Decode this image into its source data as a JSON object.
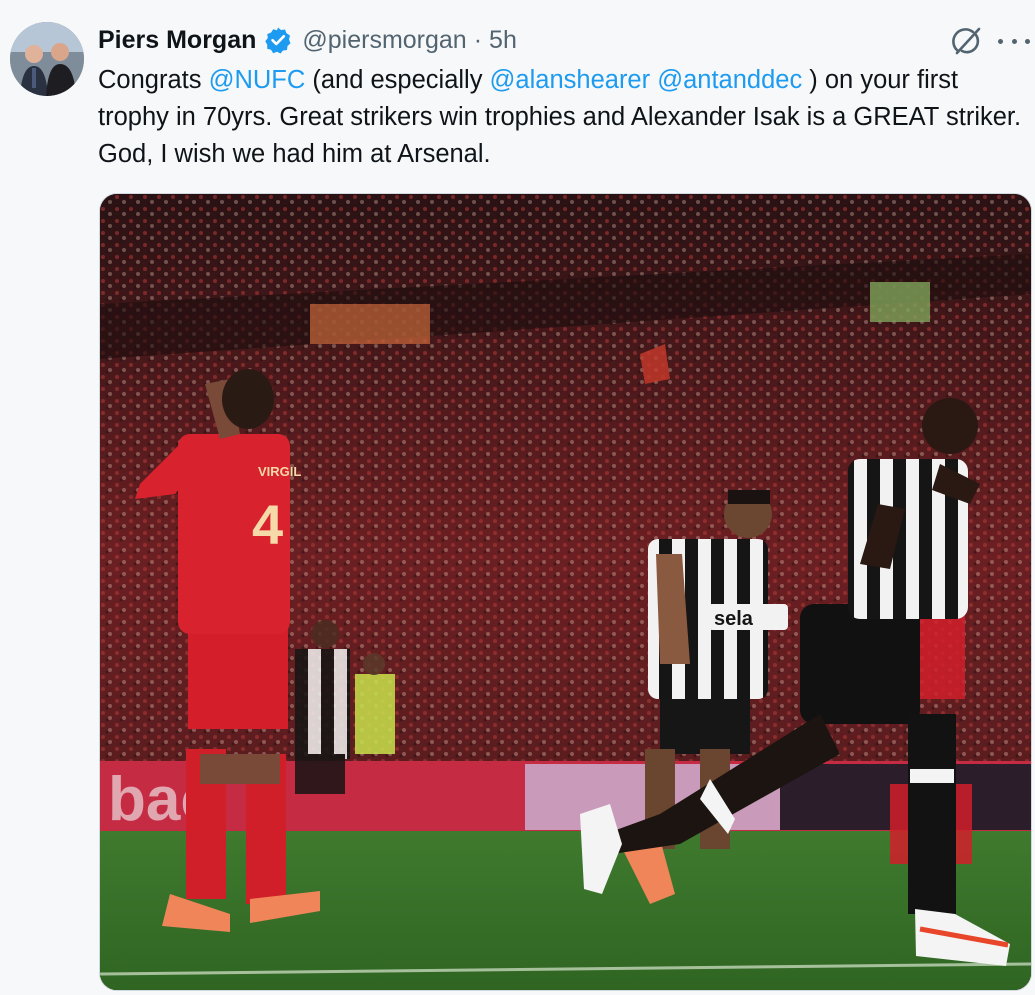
{
  "tweet": {
    "author_name": "Piers Morgan",
    "author_handle": "@piersmorgan",
    "separator": "·",
    "time": "5h",
    "text_parts": [
      {
        "text": "Congrats ",
        "mention": false
      },
      {
        "text": "@NUFC",
        "mention": true
      },
      {
        "text": " (and especially ",
        "mention": false
      },
      {
        "text": "@alanshearer",
        "mention": true
      },
      {
        "text": " ",
        "mention": false
      },
      {
        "text": "@antanddec",
        "mention": true
      },
      {
        "text": " ) on your first trophy in 70yrs. Great strikers win trophies and Alexander Isak is a GREAT striker. God, I wish we had him at Arsenal.",
        "mention": false
      }
    ],
    "photo": {
      "shirt_name": "VIRGIL",
      "shirt_number": "4",
      "sponsor": "sela",
      "board_text": "bac"
    }
  },
  "icons": {
    "verified": "verified-badge-icon",
    "grok": "grok-icon",
    "more": "more-options-icon"
  },
  "colors": {
    "link": "#1d9bf0",
    "verified": "#1d9bf0",
    "secondary_text": "#536471",
    "liverpool_red": "#d11f2a",
    "pitch_green": "#3f7a2e"
  }
}
